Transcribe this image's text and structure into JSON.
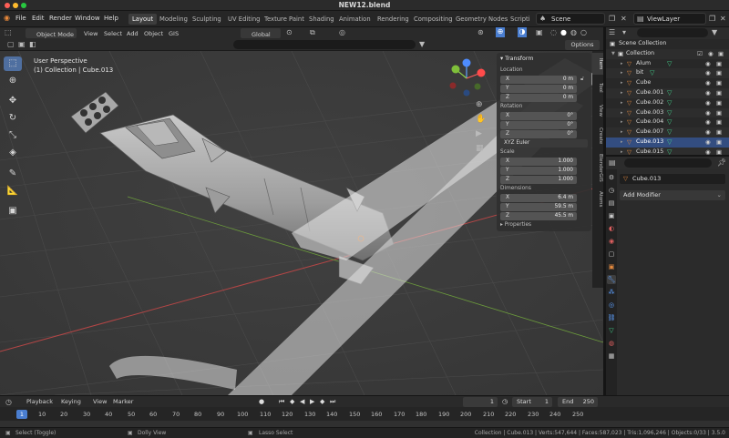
{
  "window": {
    "title": "NEW12.blend"
  },
  "menu": [
    "File",
    "Edit",
    "Render",
    "Window",
    "Help"
  ],
  "workspaces": [
    "Layout",
    "Modeling",
    "Sculpting",
    "UV Editing",
    "Texture Paint",
    "Shading",
    "Animation",
    "Rendering",
    "Compositing",
    "Geometry Nodes",
    "Scripti"
  ],
  "active_workspace": "Layout",
  "scene": "Scene",
  "view_layer": "ViewLayer",
  "header3d": {
    "mode": "Object Mode",
    "menus": [
      "View",
      "Select",
      "Add",
      "Object",
      "GIS"
    ],
    "orientation": "Global",
    "options": "Options"
  },
  "viewport": {
    "perspective": "User Perspective",
    "collection_info": "(1) Collection | Cube.013"
  },
  "n_panel": {
    "title": "Transform",
    "location_label": "Location",
    "location": {
      "x": "0 m",
      "y": "0 m",
      "z": "0 m"
    },
    "rotation_label": "Rotation",
    "rotation": {
      "x": "0°",
      "y": "0°",
      "z": "0°"
    },
    "rotation_mode": "XYZ Euler",
    "scale_label": "Scale",
    "scale": {
      "x": "1.000",
      "y": "1.000",
      "z": "1.000"
    },
    "dimensions_label": "Dimensions",
    "dimensions": {
      "x": "6.4 m",
      "y": "59.5 m",
      "z": "45.5 m"
    },
    "properties_label": "Properties",
    "axis_x": "X",
    "axis_y": "Y",
    "axis_z": "Z"
  },
  "side_tabs": [
    "Item",
    "Tool",
    "View",
    "Create",
    "BlenderGIS",
    "Atoms"
  ],
  "outliner": {
    "root": "Scene Collection",
    "collection": "Collection",
    "items": [
      "Alum",
      "bit",
      "Cube",
      "Cube.001",
      "Cube.002",
      "Cube.003",
      "Cube.004",
      "Cube.007",
      "Cube.013",
      "Cube.015"
    ],
    "selected": "Cube.013"
  },
  "properties": {
    "object_name": "Cube.013",
    "add_modifier": "Add Modifier"
  },
  "timeline": {
    "menus": [
      "Playback",
      "Keying",
      "View",
      "Marker"
    ],
    "current_frame": "1",
    "start_label": "Start",
    "start": "1",
    "end_label": "End",
    "end": "250",
    "ticks": [
      "1",
      "10",
      "20",
      "30",
      "40",
      "50",
      "60",
      "70",
      "80",
      "90",
      "100",
      "110",
      "120",
      "130",
      "140",
      "150",
      "160",
      "170",
      "180",
      "190",
      "200",
      "210",
      "220",
      "230",
      "240",
      "250"
    ]
  },
  "status": {
    "left": [
      "Select (Toggle)",
      "Dolly View",
      "Lasso Select"
    ],
    "right": "Collection | Cube.013 | Verts:547,644 | Faces:587,023 | Tris:1,096,246 | Objects:0/33 | 3.5.0"
  },
  "colors": {
    "accent": "#4a7ed0",
    "selected_row": "#334d80",
    "modifier_icon": "#41d18b",
    "mesh_icon": "#e58a3f"
  }
}
